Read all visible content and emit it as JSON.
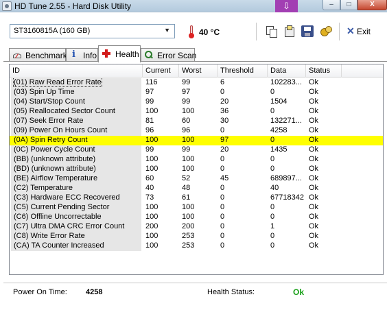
{
  "window": {
    "title": "HD Tune 2.55 - Hard Disk Utility",
    "controls": {
      "minimize": "–",
      "maximize": "□",
      "close": "X"
    }
  },
  "toolbar": {
    "drive": "ST3160815A (160 GB)",
    "temperature": "40 °C",
    "exit_label": "Exit",
    "icons": [
      "copy-text-icon",
      "copy-screenshot-icon",
      "save-icon",
      "options-icon",
      "exit-icon"
    ]
  },
  "tabs": [
    {
      "label": "Benchmark",
      "icon": "benchmark-icon",
      "active": false
    },
    {
      "label": "Info",
      "icon": "info-icon",
      "active": false
    },
    {
      "label": "Health",
      "icon": "health-icon",
      "active": true
    },
    {
      "label": "Error Scan",
      "icon": "error-scan-icon",
      "active": false
    }
  ],
  "table": {
    "columns": [
      "ID",
      "Current",
      "Worst",
      "Threshold",
      "Data",
      "Status"
    ],
    "rows": [
      {
        "id": "(01) Raw Read Error Rate",
        "current": "116",
        "worst": "99",
        "threshold": "6",
        "data": "102283...",
        "status": "Ok"
      },
      {
        "id": "(03) Spin Up Time",
        "current": "97",
        "worst": "97",
        "threshold": "0",
        "data": "0",
        "status": "Ok"
      },
      {
        "id": "(04) Start/Stop Count",
        "current": "99",
        "worst": "99",
        "threshold": "20",
        "data": "1504",
        "status": "Ok"
      },
      {
        "id": "(05) Reallocated Sector Count",
        "current": "100",
        "worst": "100",
        "threshold": "36",
        "data": "0",
        "status": "Ok"
      },
      {
        "id": "(07) Seek Error Rate",
        "current": "81",
        "worst": "60",
        "threshold": "30",
        "data": "132271...",
        "status": "Ok"
      },
      {
        "id": "(09) Power On Hours Count",
        "current": "96",
        "worst": "96",
        "threshold": "0",
        "data": "4258",
        "status": "Ok"
      },
      {
        "id": "(0A) Spin Retry Count",
        "current": "100",
        "worst": "100",
        "threshold": "97",
        "data": "0",
        "status": "Ok"
      },
      {
        "id": "(0C) Power Cycle Count",
        "current": "99",
        "worst": "99",
        "threshold": "20",
        "data": "1435",
        "status": "Ok"
      },
      {
        "id": "(BB) (unknown attribute)",
        "current": "100",
        "worst": "100",
        "threshold": "0",
        "data": "0",
        "status": "Ok"
      },
      {
        "id": "(BD) (unknown attribute)",
        "current": "100",
        "worst": "100",
        "threshold": "0",
        "data": "0",
        "status": "Ok"
      },
      {
        "id": "(BE) Airflow Temperature",
        "current": "60",
        "worst": "52",
        "threshold": "45",
        "data": "689897...",
        "status": "Ok"
      },
      {
        "id": "(C2) Temperature",
        "current": "40",
        "worst": "48",
        "threshold": "0",
        "data": "40",
        "status": "Ok"
      },
      {
        "id": "(C3) Hardware ECC Recovered",
        "current": "73",
        "worst": "61",
        "threshold": "0",
        "data": "67718342",
        "status": "Ok"
      },
      {
        "id": "(C5) Current Pending Sector",
        "current": "100",
        "worst": "100",
        "threshold": "0",
        "data": "0",
        "status": "Ok"
      },
      {
        "id": "(C6) Offline Uncorrectable",
        "current": "100",
        "worst": "100",
        "threshold": "0",
        "data": "0",
        "status": "Ok"
      },
      {
        "id": "(C7) Ultra DMA CRC Error Count",
        "current": "200",
        "worst": "200",
        "threshold": "0",
        "data": "1",
        "status": "Ok"
      },
      {
        "id": "(C8) Write Error Rate",
        "current": "100",
        "worst": "253",
        "threshold": "0",
        "data": "0",
        "status": "Ok"
      },
      {
        "id": "(CA) TA Counter Increased",
        "current": "100",
        "worst": "253",
        "threshold": "0",
        "data": "0",
        "status": "Ok"
      }
    ],
    "highlighted_row": 6,
    "highlight_color": "#ffff00"
  },
  "footer": {
    "power_on_time_label": "Power On Time:",
    "power_on_time_value": "4258",
    "health_status_label": "Health Status:",
    "health_status_value": "Ok",
    "health_status_color": "#19a019"
  }
}
